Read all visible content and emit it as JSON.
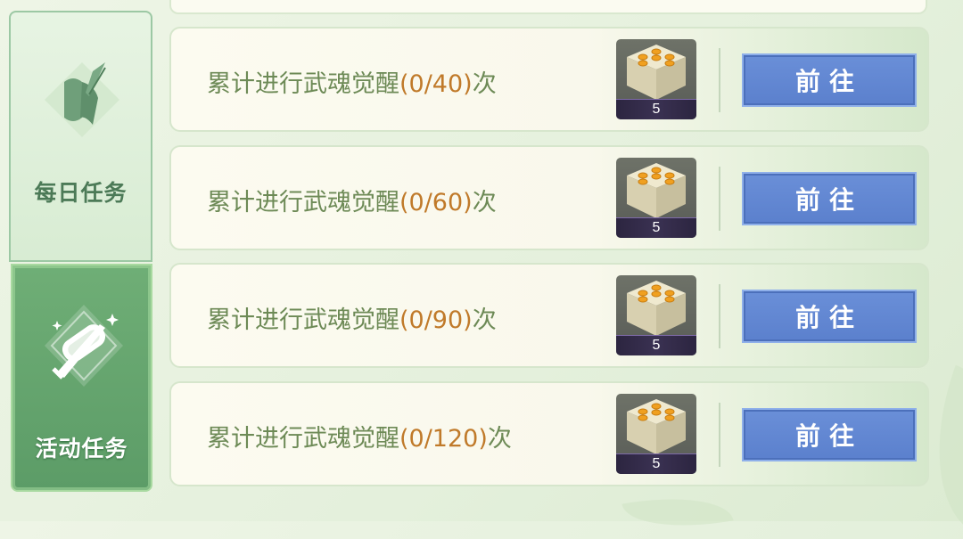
{
  "sidebar": {
    "tabs": [
      {
        "label": "每日任务",
        "icon": "quill-scroll-icon",
        "selected": false
      },
      {
        "label": "活动任务",
        "icon": "scroll-sword-icon",
        "selected": true
      }
    ]
  },
  "tasks": [
    {
      "prefix": "累计进行武魂觉醒",
      "progress": "(0/40)",
      "suffix": "次",
      "reward_icon": "dice-icon",
      "reward_count": "5",
      "button": "前往"
    },
    {
      "prefix": "累计进行武魂觉醒",
      "progress": "(0/60)",
      "suffix": "次",
      "reward_icon": "dice-icon",
      "reward_count": "5",
      "button": "前往"
    },
    {
      "prefix": "累计进行武魂觉醒",
      "progress": "(0/90)",
      "suffix": "次",
      "reward_icon": "dice-icon",
      "reward_count": "5",
      "button": "前往"
    },
    {
      "prefix": "累计进行武魂觉醒",
      "progress": "(0/120)",
      "suffix": "次",
      "reward_icon": "dice-icon",
      "reward_count": "5",
      "button": "前往"
    }
  ],
  "colors": {
    "progress": "#c07a2a",
    "task_text": "#6d8a56",
    "button": "#5b80cd",
    "selected_tab": "#5c9c67"
  }
}
